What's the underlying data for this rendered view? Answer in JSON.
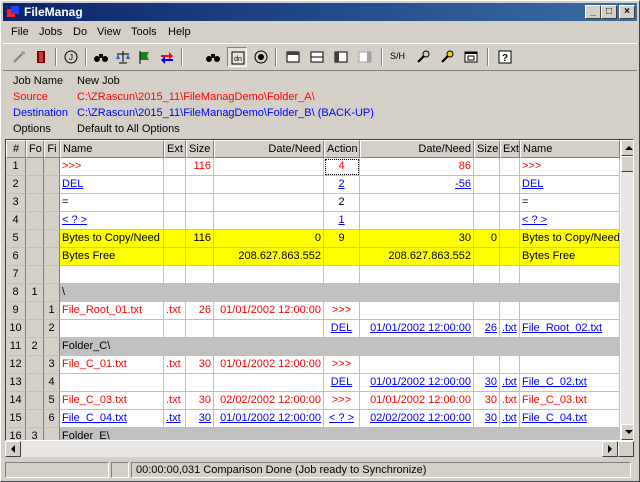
{
  "window": {
    "title": "FileManag"
  },
  "menu": [
    "File",
    "Jobs",
    "Do",
    "View",
    "Tools",
    "Help"
  ],
  "toolbar_icons": [
    "wand-icon",
    "book-icon",
    "info-circle-icon",
    "binoculars-icon",
    "balance-icon",
    "flag-icon",
    "swap-arrows-icon",
    "binoculars-small-icon",
    "compare-view-icon",
    "compare-circle-icon",
    "layout-top-icon",
    "layout-split-icon",
    "layout-side-icon",
    "layout-right-icon",
    "sh-icon",
    "tools-icon",
    "tools-gear-icon",
    "window-icon",
    "help-icon"
  ],
  "toolbar_sh_label": "S/H",
  "job": {
    "name_label": "Job Name",
    "name_value": "New Job",
    "source_label": "Source",
    "source_value": "C:\\ZRascun\\2015_11\\FileManagDemo\\Folder_A\\",
    "dest_label": "Destination",
    "dest_value": "C:\\ZRascun\\2015_11\\FileManagDemo\\Folder_B\\ (BACK-UP)",
    "options_label": "Options",
    "options_value": "Default to All Options"
  },
  "grid": {
    "headers": [
      "#",
      "Fo",
      "Fi",
      "Name",
      "Ext",
      "Size",
      "Date/Need",
      "Action",
      "Date/Need",
      "Size",
      "Ext",
      "Name"
    ],
    "rows": [
      {
        "n": "1",
        "fo": "",
        "fi": "",
        "name": ">>>",
        "ext": "",
        "size": "116",
        "date": "",
        "action": "4",
        "date2": "86",
        "size2": "",
        "ext2": "",
        "name2": ">>>",
        "style": "red",
        "focus": true
      },
      {
        "n": "2",
        "fo": "",
        "fi": "",
        "name": "DEL",
        "ext": "",
        "size": "",
        "date": "",
        "action": "2",
        "date2": "-56",
        "size2": "",
        "ext2": "",
        "name2": "DEL",
        "style": "blue-u"
      },
      {
        "n": "3",
        "fo": "",
        "fi": "",
        "name": " =",
        "ext": "",
        "size": "",
        "date": "",
        "action": "2",
        "date2": "",
        "size2": "",
        "ext2": "",
        "name2": " =",
        "style": "black"
      },
      {
        "n": "4",
        "fo": "",
        "fi": "",
        "name": "< ? >",
        "ext": "",
        "size": "",
        "date": "",
        "action": "1",
        "date2": "",
        "size2": "",
        "ext2": "",
        "name2": "< ? >",
        "style": "blue-u"
      },
      {
        "n": "5",
        "fo": "",
        "fi": "",
        "name": "Bytes to Copy/Need",
        "ext": "",
        "size": "116",
        "date": "0",
        "action": "9",
        "date2": "30",
        "size2": "0",
        "ext2": "",
        "name2": "Bytes to Copy/Need",
        "style": "yellow"
      },
      {
        "n": "6",
        "fo": "",
        "fi": "",
        "name": "Bytes Free",
        "ext": "",
        "size": "",
        "date": "208.627.863.552",
        "action": "",
        "date2": "208.627.863.552",
        "size2": "",
        "ext2": "",
        "name2": "Bytes Free",
        "style": "yellow"
      },
      {
        "n": "7",
        "fo": "",
        "fi": "",
        "name": "",
        "ext": "",
        "size": "",
        "date": "",
        "action": "",
        "date2": "",
        "size2": "",
        "ext2": "",
        "name2": "",
        "style": "black"
      },
      {
        "n": "8",
        "fo": "1",
        "fi": "",
        "name": "\\",
        "ext": "",
        "size": "",
        "date": "",
        "action": "",
        "date2": "",
        "size2": "",
        "ext2": "",
        "name2": "",
        "style": "sep"
      },
      {
        "n": "9",
        "fo": "",
        "fi": "1",
        "name": "File_Root_01.txt",
        "ext": ".txt",
        "size": "26",
        "date": "01/01/2002 12:00:00",
        "action": ">>>",
        "date2": "",
        "size2": "",
        "ext2": "",
        "name2": "",
        "style": "red"
      },
      {
        "n": "10",
        "fo": "",
        "fi": "2",
        "name": "",
        "ext": "",
        "size": "",
        "date": "",
        "action": "DEL",
        "date2": "01/01/2002 12:00:00",
        "size2": "26",
        "ext2": ".txt",
        "name2": "File_Root_02.txt",
        "style": "blue-u"
      },
      {
        "n": "11",
        "fo": "2",
        "fi": "",
        "name": "Folder_C\\",
        "ext": "",
        "size": "",
        "date": "",
        "action": "",
        "date2": "",
        "size2": "",
        "ext2": "",
        "name2": "",
        "style": "sep"
      },
      {
        "n": "12",
        "fo": "",
        "fi": "3",
        "name": "File_C_01.txt",
        "ext": ".txt",
        "size": "30",
        "date": "01/01/2002 12:00:00",
        "action": ">>>",
        "date2": "",
        "size2": "",
        "ext2": "",
        "name2": "",
        "style": "red"
      },
      {
        "n": "13",
        "fo": "",
        "fi": "4",
        "name": "",
        "ext": "",
        "size": "",
        "date": "",
        "action": "DEL",
        "date2": "01/01/2002 12:00:00",
        "size2": "30",
        "ext2": ".txt",
        "name2": "File_C_02.txt",
        "style": "blue-u"
      },
      {
        "n": "14",
        "fo": "",
        "fi": "5",
        "name": "File_C_03.txt",
        "ext": ".txt",
        "size": "30",
        "date": "02/02/2002 12:00:00",
        "action": ">>>",
        "date2": "01/01/2002 12:00:00",
        "size2": "30",
        "ext2": ".txt",
        "name2": "File_C_03.txt",
        "style": "red"
      },
      {
        "n": "15",
        "fo": "",
        "fi": "6",
        "name": "File_C_04.txt",
        "ext": ".txt",
        "size": "30",
        "date": "01/01/2002 12:00:00",
        "action": "< ? >",
        "date2": "02/02/2002 12:00:00",
        "size2": "30",
        "ext2": ".txt",
        "name2": "File_C_04.txt",
        "style": "blue-u"
      },
      {
        "n": "16",
        "fo": "3",
        "fi": "",
        "name": "Folder_E\\",
        "ext": "",
        "size": "",
        "date": "",
        "action": "",
        "date2": "",
        "size2": "",
        "ext2": "",
        "name2": "",
        "style": "sep"
      }
    ]
  },
  "status": {
    "message": "00:00:00,031 Comparison Done (Job ready to Synchronize)"
  }
}
